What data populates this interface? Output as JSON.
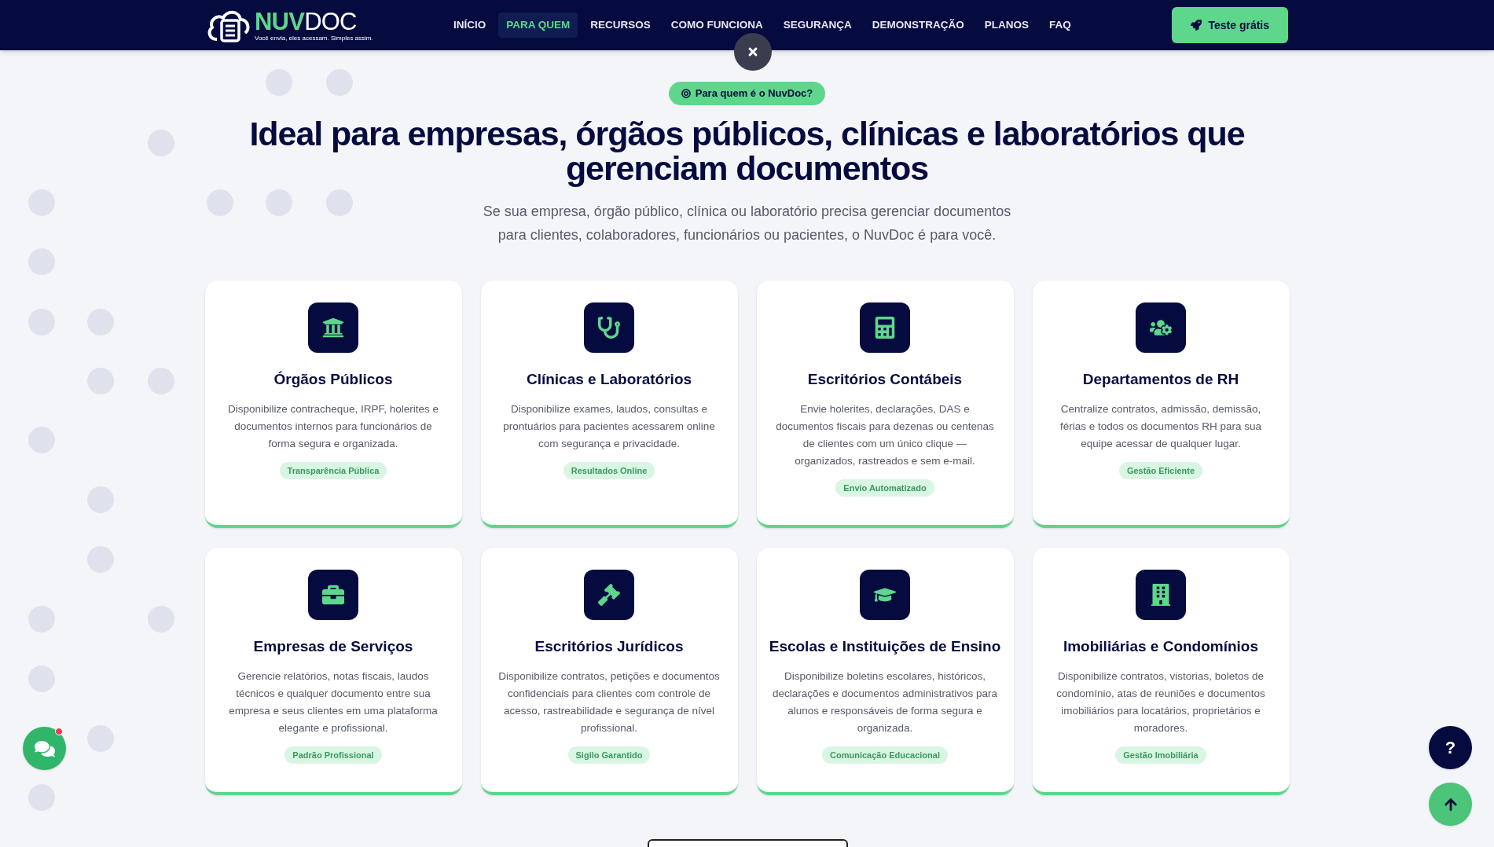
{
  "header": {
    "logo": {
      "name_bold": "NUV",
      "name_light": "DOC",
      "tagline": "Você envia, eles acessam. Simples assim."
    },
    "nav": [
      {
        "label": "INÍCIO",
        "selected": false
      },
      {
        "label": "PARA QUEM",
        "selected": true
      },
      {
        "label": "RECURSOS",
        "selected": false
      },
      {
        "label": "COMO FUNCIONA",
        "selected": false
      },
      {
        "label": "SEGURANÇA",
        "selected": false
      },
      {
        "label": "DEMONSTRAÇÃO",
        "selected": false
      },
      {
        "label": "PLANOS",
        "selected": false
      },
      {
        "label": "FAQ",
        "selected": false
      }
    ],
    "cta": "Teste grátis"
  },
  "section": {
    "badge": "Para quem é o NuvDoc?",
    "title": "Ideal para empresas, órgãos públicos, clínicas e laboratórios que gerenciam documentos",
    "subtitle": "Se sua empresa, órgão público, clínica ou laboratório precisa gerenciar documentos para clientes, colaboradores, funcionários ou pacientes, o NuvDoc é para você."
  },
  "cards": [
    {
      "title": "Órgãos Públicos",
      "text": "Disponibilize contracheque, IRPF, holerites e documentos internos para funcionários de forma segura e organizada.",
      "tag": "Transparência Pública"
    },
    {
      "title": "Clínicas e Laboratórios",
      "text": "Disponibilize exames, laudos, consultas e prontuários para pacientes acessarem online com segurança e privacidade.",
      "tag": "Resultados Online"
    },
    {
      "title": "Escritórios Contábeis",
      "text": "Envie holerites, declarações, DAS e documentos fiscais para dezenas ou centenas de clientes com um único clique — organizados, rastreados e sem e-mail.",
      "tag": "Envio Automatizado"
    },
    {
      "title": "Departamentos de RH",
      "text": "Centralize contratos, admissão, demissão, férias e todos os documentos RH para sua equipe acessar de qualquer lugar.",
      "tag": "Gestão Eficiente"
    },
    {
      "title": "Empresas de Serviços",
      "text": "Gerencie relatórios, notas fiscais, laudos técnicos e qualquer documento entre sua empresa e seus clientes em uma plataforma elegante e profissional.",
      "tag": "Padrão Profissional"
    },
    {
      "title": "Escritórios Jurídicos",
      "text": "Disponibilize contratos, petições e documentos confidenciais para clientes com controle de acesso, rastreabilidade e segurança de nível profissional.",
      "tag": "Sigilo Garantido"
    },
    {
      "title": "Escolas e Instituições de Ensino",
      "text": "Disponibilize boletins escolares, históricos, declarações e documentos administrativos para alunos e responsáveis de forma segura e organizada.",
      "tag": "Comunicação Educacional"
    },
    {
      "title": "Imobiliárias e Condomínios",
      "text": "Disponibilize contratos, vistorias, boletos de condomínio, atas de reuniões e documentos imobiliários para locatários, proprietários e moradores.",
      "tag": "Gestão Imobiliária"
    }
  ],
  "floating": {
    "help": "?"
  }
}
